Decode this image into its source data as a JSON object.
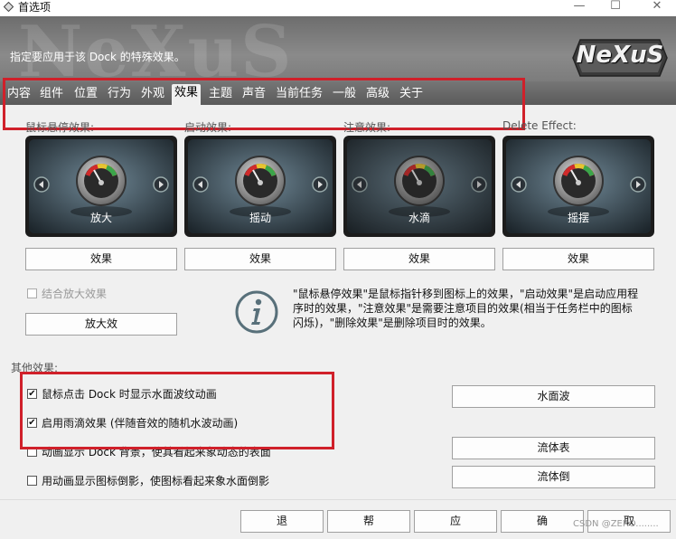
{
  "window": {
    "title": "首选项"
  },
  "banner": {
    "subtitle": "指定要应用于该 Dock 的特殊效果。",
    "logo": "NeXuS"
  },
  "tabs": [
    "内容",
    "组件",
    "位置",
    "行为",
    "外观",
    "效果",
    "主题",
    "声音",
    "当前任务",
    "一般",
    "高级",
    "关于"
  ],
  "active_tab": "效果",
  "effects": [
    {
      "title": "鼠标悬停效果:",
      "name": "放大",
      "button": "效果"
    },
    {
      "title": "启动效果:",
      "name": "摇动",
      "button": "效果"
    },
    {
      "title": "注意效果:",
      "name": "水滴",
      "button": "效果"
    },
    {
      "title": "Delete Effect:",
      "name": "摇摆",
      "button": "效果"
    }
  ],
  "combine_zoom": {
    "label": "结合放大效果",
    "checked": false,
    "enabled": false
  },
  "zoom_button": "放大效",
  "info_text_1": "\"鼠标悬停效果\"是鼠标指针移到图标上的效果，\"启动效果\"是启动应用程",
  "info_text_2": "序时的效果，\"注意效果\"是需要注意项目的效果(相当于任务栏中的图标",
  "info_text_3": "闪烁)，\"删除效果\"是删除项目时的效果。",
  "other_effects": {
    "title": "其他效果:",
    "options": [
      {
        "label": "鼠标点击 Dock 时显示水面波纹动画",
        "checked": true
      },
      {
        "label": "启用雨滴效果 (伴随音效的随机水波动画)",
        "checked": true
      },
      {
        "label": "动画显示 Dock 背景，使其看起来象动态的表面",
        "checked": false
      },
      {
        "label": "用动画显示图标倒影，使图标看起来象水面倒影",
        "checked": false
      }
    ],
    "buttons": [
      "水面波",
      "流体表",
      "流体倒"
    ]
  },
  "footer": {
    "buttons": [
      "退",
      "帮",
      "应",
      "确",
      "取"
    ],
    "watermark": "CSDN @ZERO........"
  }
}
